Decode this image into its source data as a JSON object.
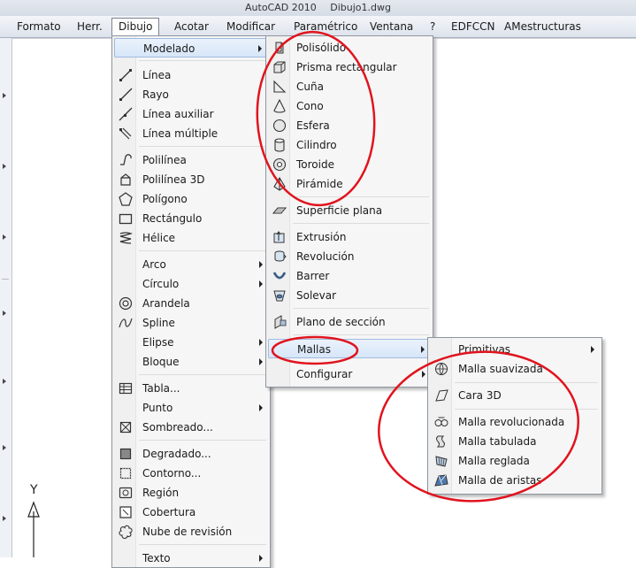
{
  "window": {
    "app": "AutoCAD 2010",
    "file": "Dibujo1.dwg"
  },
  "menubar": {
    "items": [
      {
        "label": "Formato"
      },
      {
        "label": "Herr."
      },
      {
        "label": "Dibujo"
      },
      {
        "label": "Acotar"
      },
      {
        "label": "Modificar"
      },
      {
        "label": "Paramétrico"
      },
      {
        "label": "Ventana"
      },
      {
        "label": "?"
      },
      {
        "label": "EDFCCN"
      },
      {
        "label": "AMestructuras"
      }
    ]
  },
  "dibujo_menu": {
    "items": [
      {
        "label": "Modelado"
      },
      {
        "label": "Línea"
      },
      {
        "label": "Rayo"
      },
      {
        "label": "Línea auxiliar"
      },
      {
        "label": "Línea múltiple"
      },
      {
        "label": "Polilínea"
      },
      {
        "label": "Polilínea 3D"
      },
      {
        "label": "Polígono"
      },
      {
        "label": "Rectángulo"
      },
      {
        "label": "Hélice"
      },
      {
        "label": "Arco"
      },
      {
        "label": "Círculo"
      },
      {
        "label": "Arandela"
      },
      {
        "label": "Spline"
      },
      {
        "label": "Elipse"
      },
      {
        "label": "Bloque"
      },
      {
        "label": "Tabla..."
      },
      {
        "label": "Punto"
      },
      {
        "label": "Sombreado..."
      },
      {
        "label": "Degradado..."
      },
      {
        "label": "Contorno..."
      },
      {
        "label": "Región"
      },
      {
        "label": "Cobertura"
      },
      {
        "label": "Nube de revisión"
      },
      {
        "label": "Texto"
      }
    ]
  },
  "modelado_menu": {
    "items": [
      {
        "label": "Polisólido"
      },
      {
        "label": "Prisma rectangular"
      },
      {
        "label": "Cuña"
      },
      {
        "label": "Cono"
      },
      {
        "label": "Esfera"
      },
      {
        "label": "Cilindro"
      },
      {
        "label": "Toroide"
      },
      {
        "label": "Pirámide"
      },
      {
        "label": "Superficie plana"
      },
      {
        "label": "Extrusión"
      },
      {
        "label": "Revolución"
      },
      {
        "label": "Barrer"
      },
      {
        "label": "Solevar"
      },
      {
        "label": "Plano de sección"
      },
      {
        "label": "Mallas"
      },
      {
        "label": "Configurar"
      }
    ]
  },
  "mallas_menu": {
    "items": [
      {
        "label": "Primitivas"
      },
      {
        "label": "Malla suavizada"
      },
      {
        "label": "Cara 3D"
      },
      {
        "label": "Malla revolucionada"
      },
      {
        "label": "Malla tabulada"
      },
      {
        "label": "Malla reglada"
      },
      {
        "label": "Malla de aristas"
      }
    ]
  },
  "ucs": {
    "axis_label": "Y"
  },
  "colors": {
    "annotation": "#e0141e",
    "highlight": "#d7e6f8"
  }
}
